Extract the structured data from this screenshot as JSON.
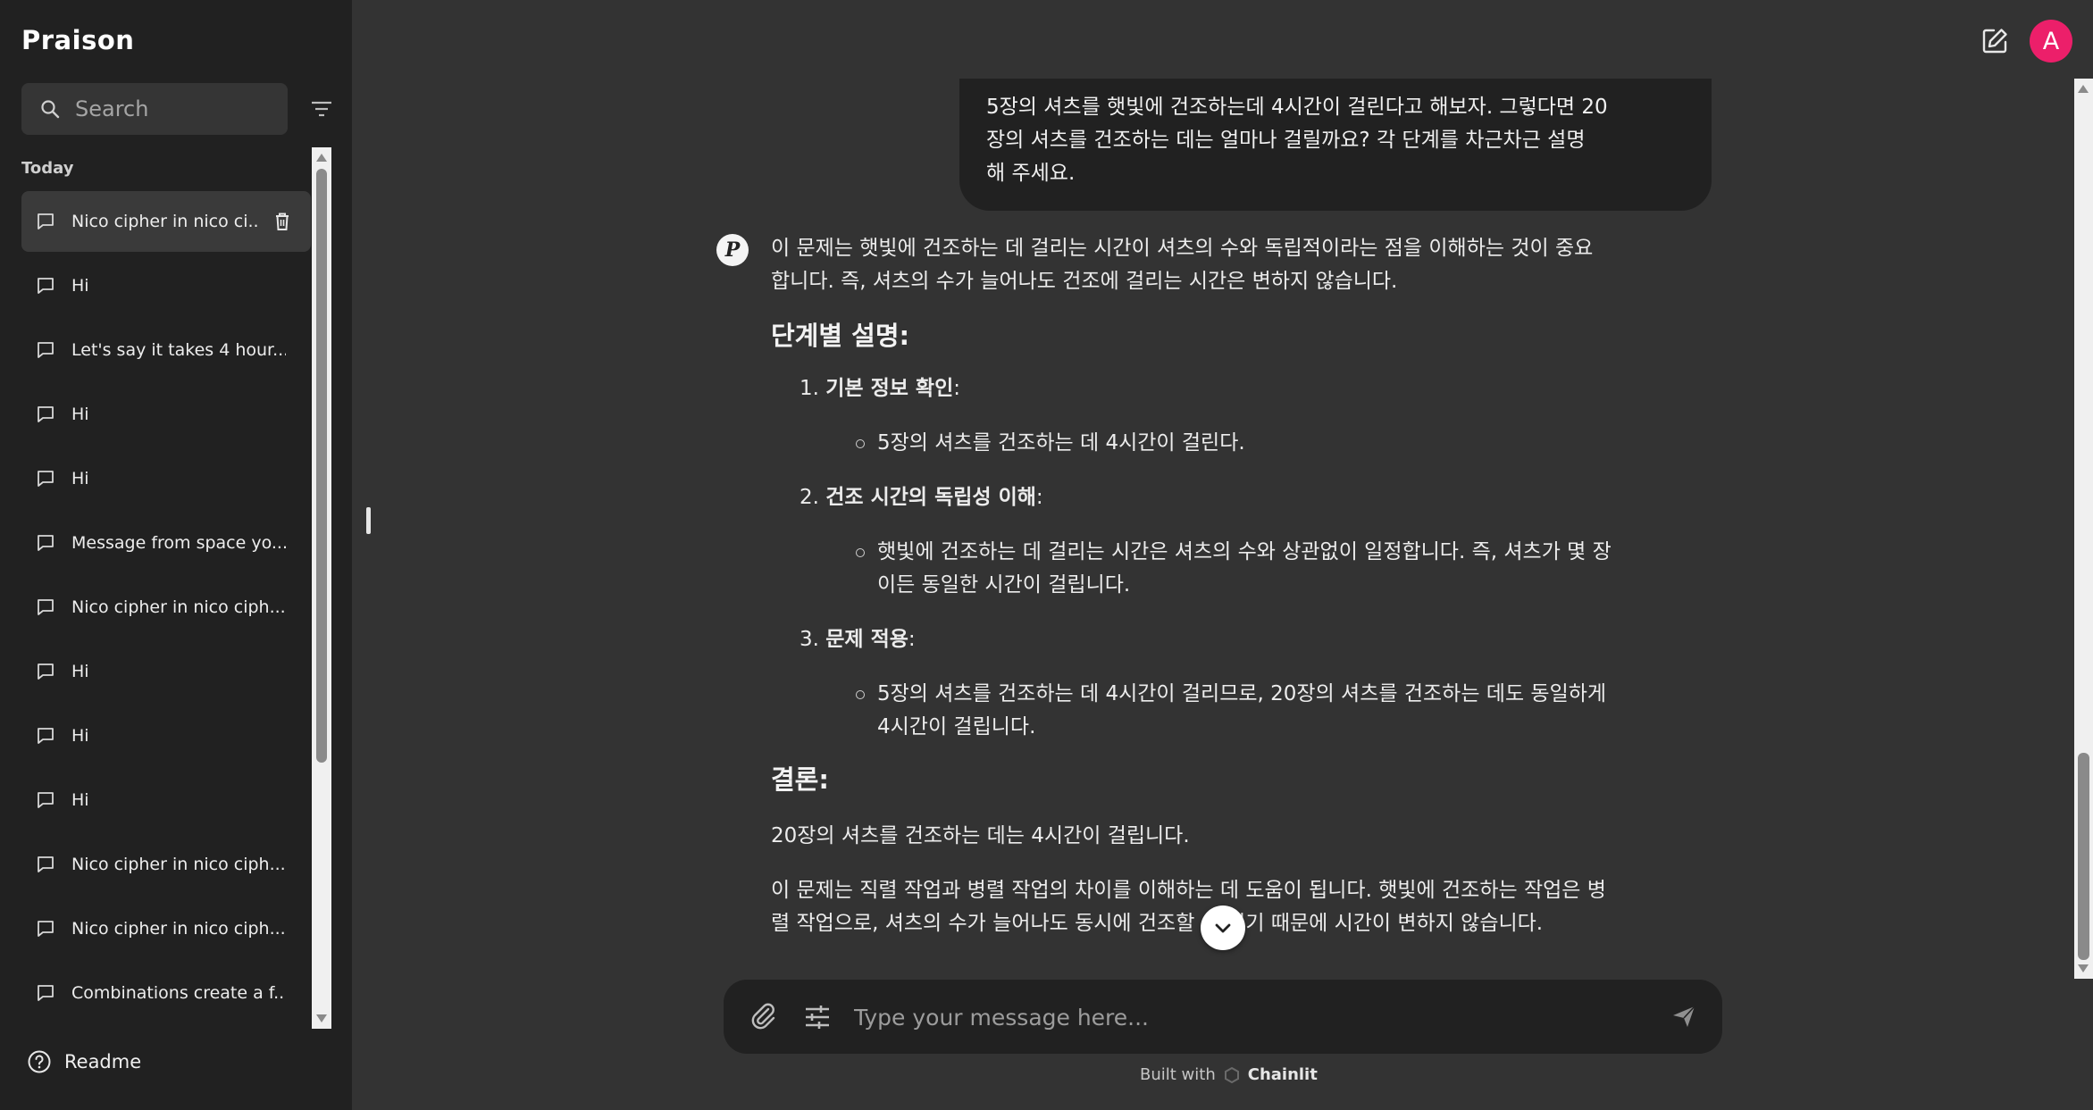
{
  "app": {
    "logo_text": "Praison"
  },
  "sidebar": {
    "search_placeholder": "Search",
    "section_label": "Today",
    "threads": [
      {
        "label": "Nico cipher in nico ci...",
        "active": true
      },
      {
        "label": "Hi"
      },
      {
        "label": "Let's say it takes 4 hour..."
      },
      {
        "label": "Hi"
      },
      {
        "label": "Hi"
      },
      {
        "label": "Message from space yo..."
      },
      {
        "label": "Nico cipher in nico ciph..."
      },
      {
        "label": "Hi"
      },
      {
        "label": "Hi"
      },
      {
        "label": "Hi"
      },
      {
        "label": "Nico cipher in nico ciph..."
      },
      {
        "label": "Nico cipher in nico ciph..."
      },
      {
        "label": "Combinations create a f..."
      }
    ],
    "readme_label": "Readme"
  },
  "header": {
    "avatar_letter": "A",
    "avatar_color": "#ec1f6a"
  },
  "chat": {
    "user_message": {
      "lines": [
        "5장의 셔츠를 햇빛에 건조하는데 4시간이 걸린다고 해보자. 그렇다면 20",
        "장의 셔츠를 건조하는 데는 얼마나 걸릴까요? 각 단계를 차근차근 설명",
        "해 주세요."
      ]
    },
    "bot_avatar_letter": "P",
    "assistant_message": {
      "intro_lines": [
        "이 문제는 햇빛에 건조하는 데 걸리는 시간이 셔츠의 수와 독립적이라는 점을 이해하는 것이 중요",
        "합니다. 즉, 셔츠의 수가 늘어나도 건조에 걸리는 시간은 변하지 않습니다."
      ],
      "steps_heading": "단계별 설명:",
      "steps": [
        {
          "num": "1.",
          "title": "기본 정보 확인",
          "colon": ":",
          "detail_lines": [
            "5장의 셔츠를 건조하는 데 4시간이 걸린다."
          ]
        },
        {
          "num": "2.",
          "title": "건조 시간의 독립성 이해",
          "colon": ":",
          "detail_lines": [
            "햇빛에 건조하는 데 걸리는 시간은 셔츠의 수와 상관없이 일정합니다. 즉, 셔츠가 몇 장",
            "이든 동일한 시간이 걸립니다."
          ]
        },
        {
          "num": "3.",
          "title": "문제 적용",
          "colon": ":",
          "detail_lines": [
            "5장의 셔츠를 건조하는 데 4시간이 걸리므로, 20장의 셔츠를 건조하는 데도 동일하게",
            "4시간이 걸립니다."
          ]
        }
      ],
      "conclusion_heading": "결론:",
      "conclusion_text": "20장의 셔츠를 건조하는 데는 4시간이 걸립니다.",
      "final_lines": [
        "이 문제는 직렬 작업과 병렬 작업의 차이를 이해하는 데 도움이 됩니다. 햇빛에 건조하는 작업은 병",
        "렬 작업으로, 셔츠의 수가 늘어나도 동시에 건조할 수 있기 때문에 시간이 변하지 않습니다."
      ]
    }
  },
  "composer": {
    "placeholder": "Type your message here..."
  },
  "footer": {
    "built_with": "Built with",
    "brand": "Chainlit"
  },
  "colors": {
    "background": "#333333",
    "sidebar": "#212121",
    "bubble": "#212121",
    "accent": "#ec1f6a"
  },
  "icons": [
    "search-icon",
    "filter-icon",
    "chat-bubble-icon",
    "trash-icon",
    "help-circle-icon",
    "new-chat-icon",
    "chevron-down-icon",
    "paperclip-icon",
    "settings-sliders-icon",
    "send-icon",
    "chainlit-icon"
  ]
}
